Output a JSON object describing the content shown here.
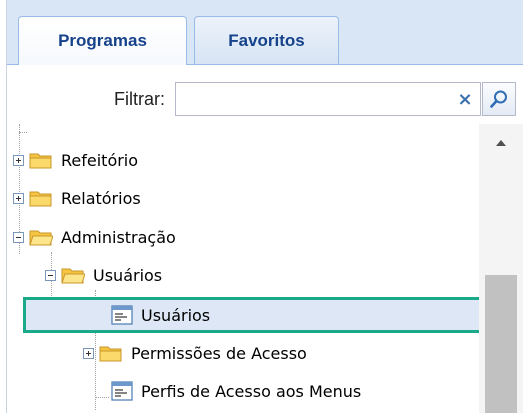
{
  "tabs": [
    {
      "label": "Programas",
      "active": true
    },
    {
      "label": "Favoritos",
      "active": false
    }
  ],
  "filter": {
    "label": "Filtrar:",
    "value": "",
    "placeholder": "",
    "clear_symbol": "×",
    "search_icon": "magnifier-icon"
  },
  "tree": {
    "items": [
      {
        "label": "Refeitório",
        "type": "folder",
        "expanded": false,
        "level": 0
      },
      {
        "label": "Relatórios",
        "type": "folder",
        "expanded": false,
        "level": 0
      },
      {
        "label": "Administração",
        "type": "folder",
        "expanded": true,
        "level": 0
      },
      {
        "label": "Usuários",
        "type": "folder",
        "expanded": true,
        "level": 1
      },
      {
        "label": "Usuários",
        "type": "program",
        "selected": true,
        "level": 2
      },
      {
        "label": "Permissões de Acesso",
        "type": "folder",
        "expanded": false,
        "level": 2
      },
      {
        "label": "Perfis de Acesso aos Menus",
        "type": "program",
        "level": 2
      }
    ]
  },
  "colors": {
    "tab_text": "#15428b",
    "selection_border": "#1aaa8a",
    "selection_fill": "#dde7f5",
    "folder": "#f5c542"
  }
}
